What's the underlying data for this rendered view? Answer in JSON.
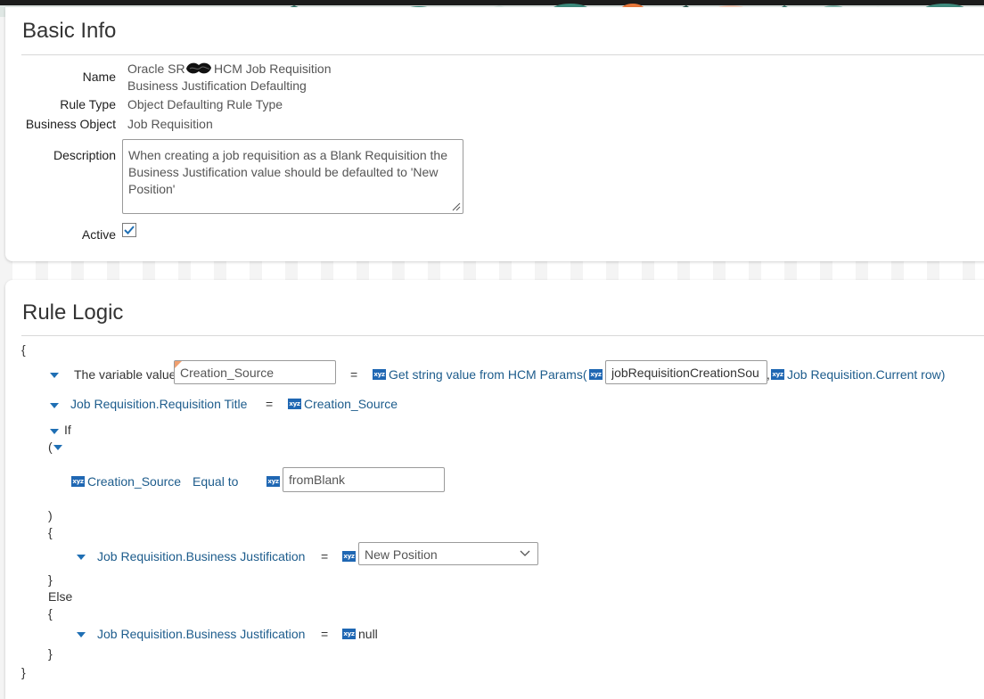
{
  "basic_info": {
    "title": "Basic Info",
    "name_label": "Name",
    "name_value_line1": "Oracle SR",
    "name_value_line1b": "HCM Job Requisition",
    "name_value_line2": "Business Justification Defaulting",
    "rule_type_label": "Rule Type",
    "rule_type_value": "Object Defaulting Rule Type",
    "business_object_label": "Business Object",
    "business_object_value": "Job Requisition",
    "description_label": "Description",
    "description_value": "When creating a job requisition as a Blank Requisition the Business Justification value should be defaulted to 'New Position'",
    "active_label": "Active",
    "active_checked": true
  },
  "rule_logic": {
    "title": "Rule Logic",
    "open_brace": "{",
    "close_brace": "}",
    "line1": {
      "prefix": "The variable value",
      "variable_input": "Creation_Source",
      "equals": "=",
      "function_label": "Get string value from HCM Params(",
      "param_input": "jobRequisitionCreationSou",
      "comma": ",",
      "param2_label": "Job Requisition.Current row)"
    },
    "line2": {
      "target": "Job Requisition.Requisition Title",
      "equals": "=",
      "value": "Creation_Source"
    },
    "if_block": {
      "if_label": "If",
      "open_paren": "(",
      "cond_left": "Creation_Source",
      "operator": "Equal to",
      "cond_right": "fromBlank",
      "close_paren": ")",
      "open_brace": "{",
      "then_target": "Job Requisition.Business Justification",
      "then_equals": "=",
      "then_value": "New Position",
      "close_brace": "}",
      "else_label": "Else",
      "else_open_brace": "{",
      "else_target": "Job Requisition.Business Justification",
      "else_equals": "=",
      "else_value": "null",
      "else_close_brace": "}"
    }
  },
  "icons": {
    "type_badge": "xyz-type-icon",
    "expand": "triangle-down-icon",
    "dropdown": "chevron-down-icon",
    "checkmark": "checkmark-icon",
    "resize": "resize-grip-icon"
  },
  "colors": {
    "link": "#1d5c8c",
    "badge": "#1f67b3",
    "triangle": "#1f6fb4",
    "checkmark": "#1f6fb4"
  }
}
